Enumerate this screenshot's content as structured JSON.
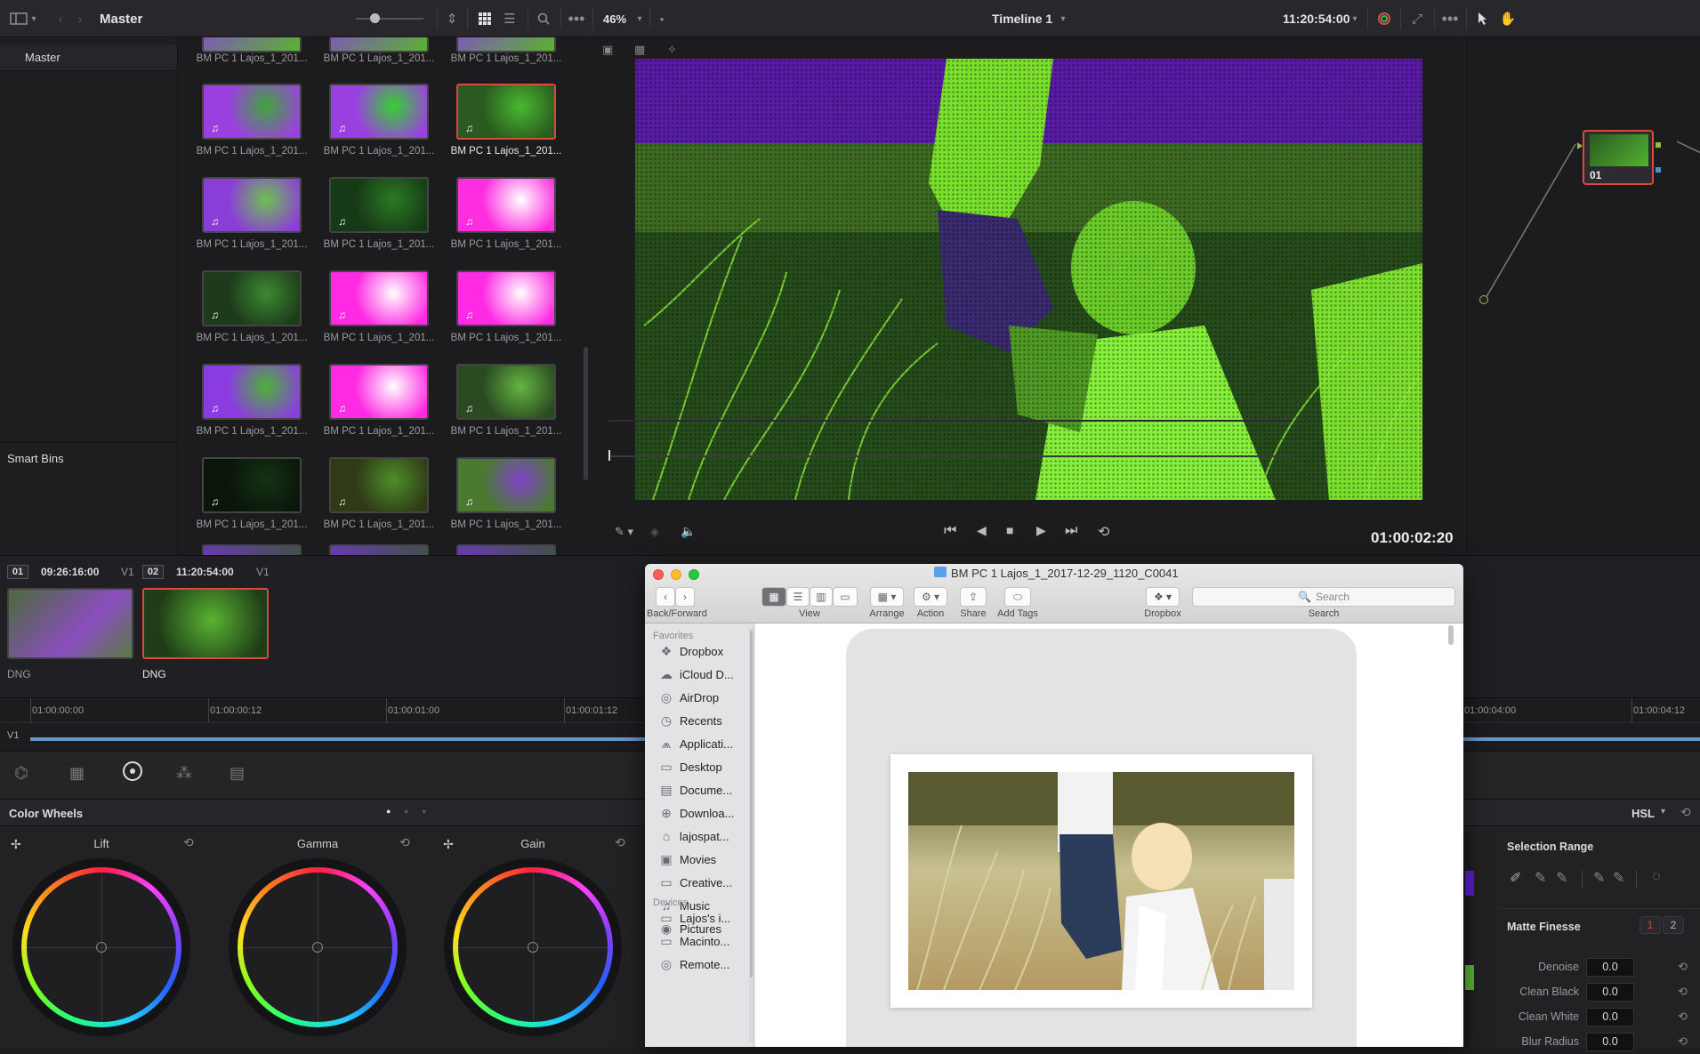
{
  "topbar": {
    "bin_name": "Master",
    "zoom": "46%",
    "timeline_name": "Timeline 1",
    "timecode": "11:20:54:00"
  },
  "bins": {
    "master": "Master",
    "smart_bins": "Smart Bins"
  },
  "media_pool": {
    "clip_label": "BM PC 1 Lajos_1_201...",
    "clips": [
      {
        "c": "#9b40e0",
        "c2": "#3fa53c"
      },
      {
        "c": "#9b40e0",
        "c2": "#36d030"
      },
      {
        "c": "#2a5a20",
        "c2": "#49b830",
        "selected": true
      },
      {
        "c": "#8a3ed8",
        "c2": "#6fc050"
      },
      {
        "c": "#173a16",
        "c2": "#2a7a24"
      },
      {
        "c": "#ff2de0",
        "c2": "#ffffff"
      },
      {
        "c": "#1d3a1b",
        "c2": "#3c8a30"
      },
      {
        "c": "#ff2ae3",
        "c2": "#ffffff"
      },
      {
        "c": "#ff2ae3",
        "c2": "#ffffff"
      },
      {
        "c": "#8b3ce0",
        "c2": "#4bb236"
      },
      {
        "c": "#ff2ae3",
        "c2": "#ffffff"
      },
      {
        "c": "#2a4a22",
        "c2": "#63b540"
      },
      {
        "c": "#0b160b",
        "c2": "#143214"
      },
      {
        "c": "#2f3a16",
        "c2": "#4e8e2a"
      },
      {
        "c": "#4a7a30",
        "c2": "#8045c8"
      }
    ]
  },
  "viewer": {
    "timecode": "01:00:02:20"
  },
  "node": {
    "label": "01"
  },
  "clips": [
    {
      "num": "01",
      "tc": "09:26:16:00",
      "track": "V1",
      "codec": "DNG"
    },
    {
      "num": "02",
      "tc": "11:20:54:00",
      "track": "V1",
      "codec": "DNG"
    }
  ],
  "ruler": {
    "track": "V1",
    "ticks": [
      "01:00:00:00",
      "01:00:00:12",
      "01:00:01:00",
      "01:00:01:12",
      "01:00:04:00",
      "01:00:04:12"
    ]
  },
  "color_wheels": {
    "title": "Color Wheels",
    "wheels": [
      "Lift",
      "Gamma",
      "Gain"
    ]
  },
  "qualifier": {
    "mode": "HSL",
    "selection_range": "Selection Range",
    "matte_finesse": "Matte Finesse",
    "page1": "1",
    "page2": "2",
    "params": [
      {
        "label": "Denoise",
        "value": "0.0"
      },
      {
        "label": "Clean Black",
        "value": "0.0"
      },
      {
        "label": "Clean White",
        "value": "0.0"
      },
      {
        "label": "Blur Radius",
        "value": "0.0"
      }
    ]
  },
  "finder": {
    "title": "BM PC 1 Lajos_1_2017-12-29_1120_C0041",
    "toolbar": {
      "back_forward": "Back/Forward",
      "view": "View",
      "arrange": "Arrange",
      "action": "Action",
      "share": "Share",
      "add_tags": "Add Tags",
      "dropbox": "Dropbox",
      "search": "Search",
      "search_placeholder": "Search"
    },
    "favorites_label": "Favorites",
    "favorites": [
      "Dropbox",
      "iCloud D...",
      "AirDrop",
      "Recents",
      "Applicati...",
      "Desktop",
      "Docume...",
      "Downloa...",
      "lajospat...",
      "Movies",
      "Creative...",
      "Music",
      "Pictures"
    ],
    "devices_label": "Devices",
    "devices": [
      "Lajos's i...",
      "Macinto...",
      "Remote..."
    ]
  },
  "colors": {
    "accent": "#d84a3c",
    "purple": "#5d1ea8",
    "green": "#6ee02a"
  }
}
